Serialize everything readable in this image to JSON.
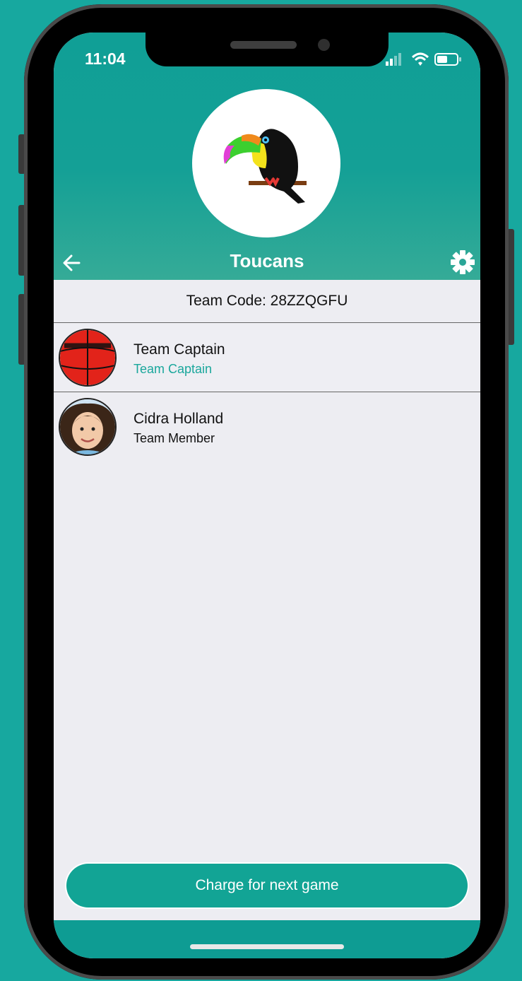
{
  "status_bar": {
    "time": "11:04"
  },
  "team": {
    "name": "Toucans",
    "code_label": "Team Code: 28ZZQGFU"
  },
  "members": [
    {
      "name": "Team Captain",
      "role": "Team Captain",
      "role_color": "#1aa79c"
    },
    {
      "name": "Cidra Holland",
      "role": "Team Member",
      "role_color": "#111111"
    }
  ],
  "actions": {
    "charge_label": "Charge for next game"
  },
  "icons": {
    "back": "arrow-left-icon",
    "settings": "gear-icon",
    "signal": "signal-icon",
    "wifi": "wifi-icon",
    "battery": "battery-icon"
  },
  "colors": {
    "accent": "#12a495",
    "background": "#17a89f",
    "screen_bg": "#ededf2"
  }
}
